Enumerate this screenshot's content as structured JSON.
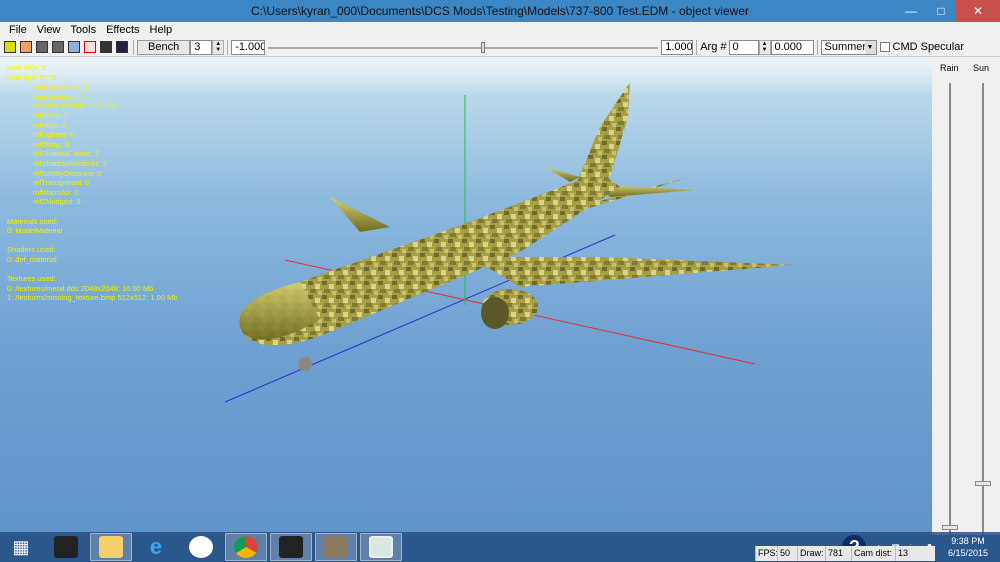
{
  "window": {
    "title": "C:\\Users\\kyran_000\\Documents\\DCS Mods\\Testing\\Models\\737-800 Test.EDM - object viewer"
  },
  "menu": [
    "File",
    "View",
    "Tools",
    "Effects",
    "Help"
  ],
  "toolbar": {
    "bench_label": "Bench",
    "bench_value": "3",
    "min_value": "-1.000",
    "slider_fraction": 0.55,
    "max_value": "1.000",
    "arg_label": "Arg #",
    "arg_value": "0",
    "arg_float": "0.000",
    "season": "Summer",
    "cmd_specular_label": "CMD Specular",
    "cmd_specular_checked": false
  },
  "info": {
    "top": [
      "num objs: 2",
      "num tigs: 8778"
    ],
    "details": [
      "num materials: 1",
      "num textures: 2",
      "textures weight: 17.00Mb",
      "mfEffect: 0",
      "mfHalo: 0",
      "mfLighted: 0",
      "mfOnlay: 0",
      "mfShadowCaster: 2",
      "mfShadowReceiver: 2",
      "mfSortByDistance: 0",
      "mfTransparent: 0",
      "mfWarmAir: 0",
      "mfZNudged: 0"
    ],
    "materials_header": "Materials used:",
    "materials": [
      "0: ModelMaterial"
    ],
    "shaders_header": "Shaders used:",
    "shaders": [
      "0: def_material"
    ],
    "textures_header": "Textures used:",
    "textures": [
      "0: /textures/metal.dds 2048x2048: 16.00 Mb",
      "1: /textures/missing_texture.bmp 512x512: 1.00 Mb"
    ]
  },
  "right_panel": {
    "rain_label": "Rain",
    "sun_label": "Sun",
    "rain_fraction": 0.0,
    "sun_fraction": 0.1
  },
  "status": {
    "fps_label": "FPS:",
    "fps_value": "50",
    "draw_label": "Draw:",
    "draw_value": "781",
    "cam_label": "Cam dist:",
    "cam_value": "13"
  },
  "taskbar": {
    "apps": [
      "start",
      "touch-keyboard",
      "file-explorer",
      "internet-explorer",
      "hp",
      "chrome",
      "3ds-max",
      "gimp",
      "object-viewer"
    ],
    "time": "9:38 PM",
    "date": "6/15/2015"
  },
  "colors": {
    "info_text": "#f2f200",
    "x_axis": "#e03030",
    "y_axis": "#20c040",
    "z_axis": "#2030d0"
  }
}
